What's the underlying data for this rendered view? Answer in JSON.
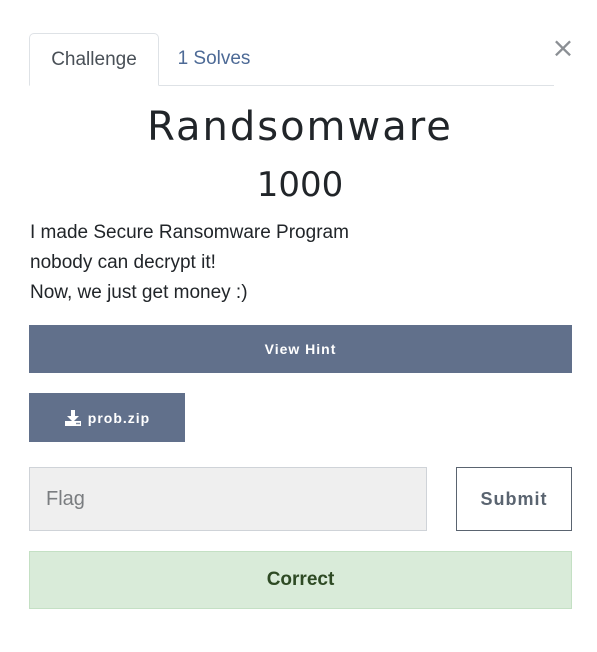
{
  "tabs": {
    "challenge_label": "Challenge",
    "solves_label": "1 Solves"
  },
  "close_symbol": "×",
  "challenge": {
    "name": "Randsomware",
    "points": "1000",
    "description": [
      "I made Secure Ransomware Program",
      "nobody can decrypt it!",
      "Now, we just get money :)"
    ]
  },
  "hint_button_label": "View Hint",
  "file": {
    "name": "prob.zip",
    "icon": "download-icon"
  },
  "flag_input": {
    "placeholder": "Flag",
    "value": ""
  },
  "submit_label": "Submit",
  "result_message": "Correct",
  "colors": {
    "button_bg": "#61708b",
    "solves_link": "#4d6a96",
    "success_bg": "#d9ebd9",
    "success_text": "#2e4a24"
  }
}
